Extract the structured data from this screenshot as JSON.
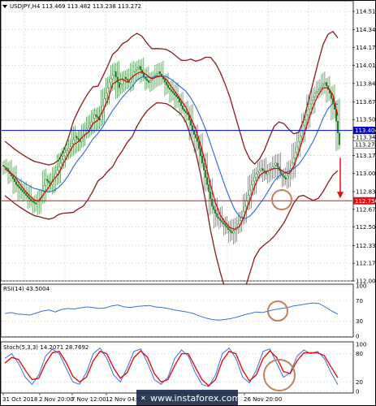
{
  "header": {
    "title": "USDJPY,H4  113.469 113.482 113.238 113.272"
  },
  "chart_data": [
    {
      "type": "line",
      "panel": "price",
      "ylim": [
        112.005,
        114.51
      ],
      "y_ticks": [
        112.005,
        112.17,
        112.335,
        112.505,
        112.67,
        112.835,
        113.005,
        113.17,
        113.34,
        113.505,
        113.67,
        113.84,
        114.01,
        114.175,
        114.34,
        114.51
      ],
      "x_tick_labels": [
        "31 Oct 2018",
        "2 Nov 20:00",
        "7 Nov 12:00",
        "12 Nov 04:00",
        "26 Nov 20:00"
      ],
      "close_series": [
        113.05,
        112.98,
        112.9,
        112.85,
        112.8,
        112.75,
        112.72,
        112.78,
        112.95,
        112.9,
        113.0,
        113.1,
        113.2,
        113.25,
        113.35,
        113.3,
        113.4,
        113.45,
        113.55,
        113.5,
        113.7,
        113.85,
        113.95,
        113.8,
        113.9,
        113.85,
        113.95,
        114.0,
        113.9,
        113.85,
        113.9,
        113.95,
        113.88,
        113.8,
        113.75,
        113.7,
        113.6,
        113.55,
        113.4,
        113.3,
        113.1,
        112.9,
        112.7,
        112.6,
        112.55,
        112.5,
        112.45,
        112.5,
        112.6,
        112.75,
        112.9,
        113.0,
        113.05,
        113.0,
        113.05,
        113.1,
        113.0,
        112.95,
        113.05,
        113.2,
        113.35,
        113.5,
        113.65,
        113.75,
        113.8,
        113.85,
        113.75,
        113.6,
        113.27
      ],
      "horizontal_lines": [
        {
          "value": 113.404,
          "label": "113.404",
          "color": "#0000cc"
        },
        {
          "value": 112.75,
          "label": "112.750",
          "color": "#e01010"
        }
      ],
      "current_price": {
        "value": 113.272,
        "label": "113.272"
      },
      "forecast_arrow": {
        "from": 113.27,
        "to": 112.75,
        "color": "#e01010"
      },
      "colors": {
        "candles": "#1a7a1a",
        "ma_fast": "#d01010",
        "ma_mid": "#3a6fd8",
        "bands": "#8b1a1a"
      }
    },
    {
      "type": "line",
      "panel": "rsi",
      "title": "RSI(14) 43.5004",
      "ylim": [
        0,
        100
      ],
      "y_tick_labels": [
        "100",
        "70",
        "30",
        "0"
      ],
      "values": [
        45,
        47,
        44,
        43,
        42,
        46,
        50,
        52,
        48,
        53,
        55,
        54,
        56,
        58,
        57,
        55,
        56,
        60,
        62,
        58,
        57,
        59,
        60,
        61,
        58,
        57,
        55,
        52,
        50,
        48,
        45,
        40,
        36,
        33,
        32,
        33,
        35,
        38,
        42,
        45,
        48,
        47,
        50,
        53,
        55,
        57,
        60,
        62,
        64,
        66,
        65,
        58,
        50,
        43.5
      ],
      "color": "#3a6fd8"
    },
    {
      "type": "line",
      "panel": "stochastic",
      "title": "Stoch(5,3,3) 14.2071 28.7692",
      "ylim": [
        0,
        100
      ],
      "y_tick_labels": [
        "100",
        "80",
        "20",
        "0"
      ],
      "series": [
        {
          "values": [
            70,
            80,
            60,
            30,
            15,
            35,
            75,
            90,
            80,
            50,
            20,
            15,
            40,
            80,
            92,
            70,
            35,
            20,
            50,
            85,
            90,
            60,
            25,
            15,
            30,
            70,
            88,
            75,
            40,
            15,
            10,
            35,
            80,
            92,
            70,
            30,
            18,
            45,
            85,
            90,
            60,
            30,
            40,
            75,
            88,
            80,
            85,
            70,
            40,
            14.2
          ],
          "color": "#3a6fd8"
        },
        {
          "values": [
            60,
            72,
            68,
            45,
            25,
            28,
            60,
            82,
            85,
            62,
            32,
            20,
            30,
            65,
            85,
            80,
            50,
            28,
            40,
            72,
            86,
            72,
            38,
            20,
            25,
            55,
            80,
            80,
            52,
            25,
            12,
            25,
            65,
            85,
            80,
            45,
            22,
            35,
            70,
            86,
            72,
            42,
            38,
            65,
            82,
            82,
            82,
            76,
            52,
            28.8
          ],
          "color": "#e01010"
        }
      ]
    }
  ],
  "watermark": "www.instaforex.com"
}
